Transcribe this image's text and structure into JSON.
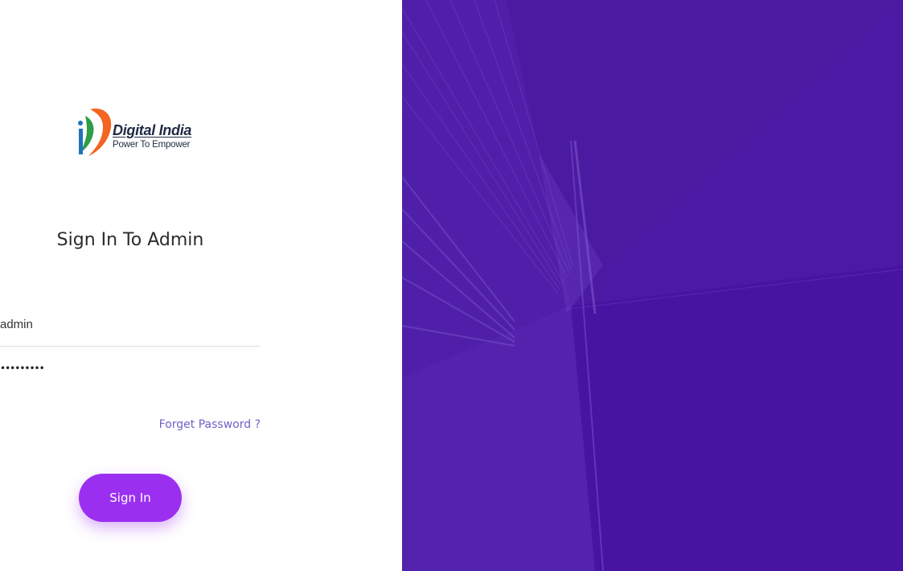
{
  "logo": {
    "title": "Digital India",
    "tagline": "Power To Empower",
    "icon": "digital-india-logo"
  },
  "form": {
    "heading": "Sign In To Admin",
    "username_value": "admin",
    "password_mask": "•••••••••",
    "forgot_label": "Forget Password ?",
    "signin_label": "Sign In"
  },
  "colors": {
    "accent": "#9b2ff0",
    "link": "#6c63c7",
    "panel": "#4b1aa2"
  }
}
